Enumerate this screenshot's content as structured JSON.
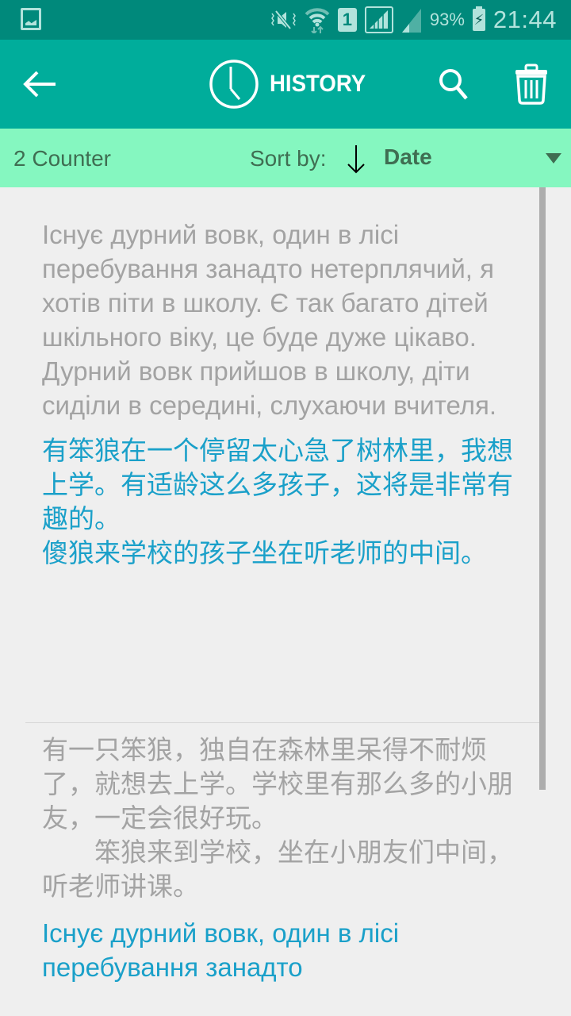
{
  "statusbar": {
    "icons": [
      "screenshot-icon",
      "vibrate-mute-icon",
      "wifi-icon",
      "sim1-icon",
      "signal-icon",
      "signal-2-icon",
      "battery-charging-icon"
    ],
    "sim_label": "1",
    "battery_percent": "93%",
    "time": "21:44"
  },
  "appbar": {
    "back_icon": "arrow-left-icon",
    "title_icon": "clock-icon",
    "title": "HISTORY",
    "search_icon": "search-icon",
    "delete_icon": "trash-icon"
  },
  "sortbar": {
    "counter": "2 Counter",
    "sort_label": "Sort by:",
    "sort_direction_icon": "arrow-down-icon",
    "sort_value": "Date"
  },
  "colors": {
    "statusbar": "#00897b",
    "appbar": "#00ad9b",
    "sortbar": "#85f7c0",
    "source_text": "#a3a3a3",
    "translated_text": "#1aa0c9"
  },
  "entries": [
    {
      "source": "Існує дурний вовк, один в лісі перебування занадто нетерплячий, я хотів піти в школу. Є так багато дітей шкільного віку, це буде дуже цікаво.\nДурний вовк прийшов в школу, діти сиділи в середині, слухаючи вчителя.",
      "translation": "有笨狼在一个停留太心急了树林里，我想上学。有适龄这么多孩子，这将是非常有趣的。\n傻狼来学校的孩子坐在听老师的中间。"
    },
    {
      "source": "有一只笨狼，独自在森林里呆得不耐烦了，就想去上学。学校里有那么多的小朋友，一定会很好玩。\n　　笨狼来到学校，坐在小朋友们中间，听老师讲课。",
      "translation": "Існує дурний вовк, один в лісі перебування занадто"
    }
  ]
}
